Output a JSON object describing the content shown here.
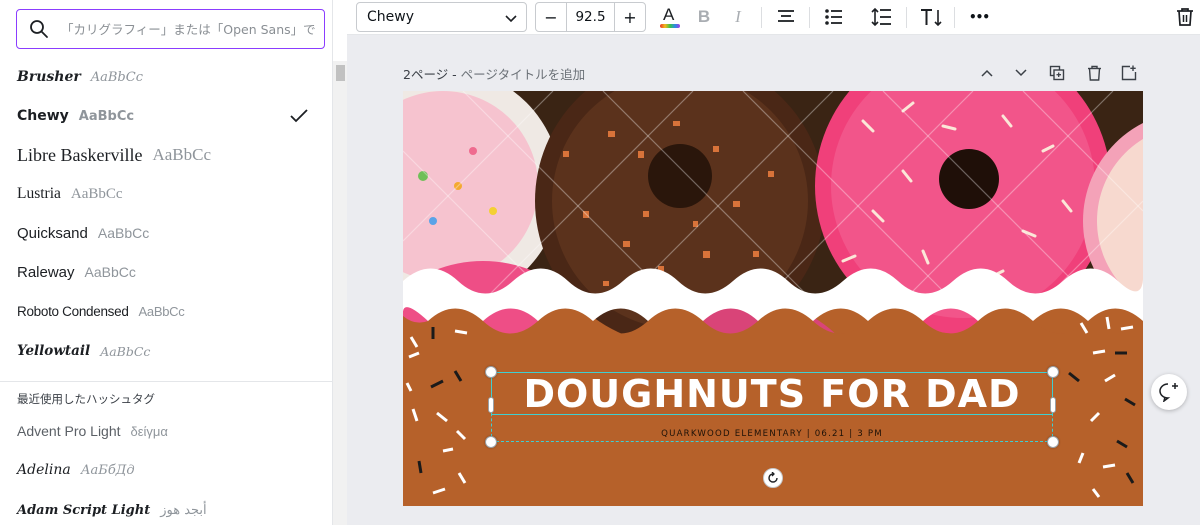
{
  "search": {
    "placeholder": "「カリグラフィー」または「Open Sans」で検索"
  },
  "fonts": [
    {
      "name": "Brusher",
      "sample": "AaBbCc",
      "selected": false
    },
    {
      "name": "Chewy",
      "sample": "AaBbCc",
      "selected": true
    },
    {
      "name": "Libre Baskerville",
      "sample": "AaBbCc",
      "selected": false
    },
    {
      "name": "Lustria",
      "sample": "AaBbCc",
      "selected": false
    },
    {
      "name": "Quicksand",
      "sample": "AaBbCc",
      "selected": false
    },
    {
      "name": "Raleway",
      "sample": "AaBbCc",
      "selected": false
    },
    {
      "name": "Roboto Condensed",
      "sample": "AaBbCc",
      "selected": false
    },
    {
      "name": "Yellowtail",
      "sample": "AaBbCc",
      "selected": false
    }
  ],
  "recent_section": {
    "title": "最近使用したハッシュタグ",
    "fonts": [
      {
        "name": "Advent Pro Light",
        "sample": "δείγμα"
      },
      {
        "name": "Adelina",
        "sample": "АаБбДд"
      },
      {
        "name": "Adam Script Light",
        "sample": "أبجد هوز"
      }
    ]
  },
  "toolbar": {
    "font_family": "Chewy",
    "font_size": "92.5",
    "minus": "−",
    "plus": "+",
    "text_color_letter": "A",
    "bold_letter": "B",
    "italic_letter": "I",
    "more": "•••"
  },
  "page": {
    "label": "2ページ",
    "separator": " - ",
    "title_placeholder": "ページタイトルを追加"
  },
  "design": {
    "headline": "DOUGHNUTS FOR DAD",
    "subline": "QUARKWOOD ELEMENTARY | 06.21 | 3 PM"
  },
  "colors": {
    "accent": "#8b3dff",
    "selection": "#3fcfd1",
    "canvas_brown": "#b6612a",
    "donut_pink": "#f0407a",
    "chocolate": "#4a2716"
  },
  "icons": {
    "search": "search-icon",
    "check": "check-icon",
    "chevron": "chevron-down-icon",
    "align": "align-center-icon",
    "list": "bullet-list-icon",
    "spacing": "line-spacing-icon",
    "text_direction": "text-direction-icon",
    "trash": "trash-icon",
    "comment": "add-comment-icon",
    "rotate": "rotate-icon"
  }
}
